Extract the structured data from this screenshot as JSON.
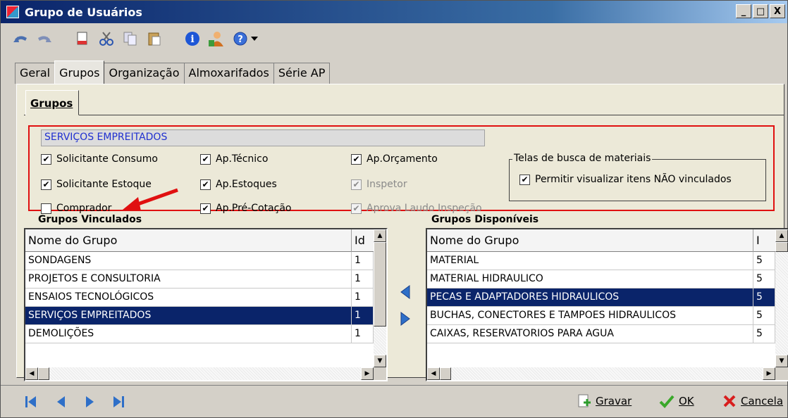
{
  "window": {
    "title": "Grupo de Usuários"
  },
  "titlebar_buttons": [
    "_",
    "□",
    "X"
  ],
  "toolbar": {
    "icons": [
      "undo-icon",
      "redo-icon",
      "new-document-icon",
      "cut-icon",
      "copy-icon",
      "paste-icon",
      "info-icon",
      "user-icon",
      "help-icon",
      "dropdown-arrow-icon"
    ]
  },
  "tabs": [
    {
      "label": "Geral",
      "active": false
    },
    {
      "label": "Grupos",
      "active": true
    },
    {
      "label": "Organização",
      "active": false
    },
    {
      "label": "Almoxarifados",
      "active": false
    },
    {
      "label": "Série AP",
      "active": false
    }
  ],
  "subtab": {
    "label": "Grupos"
  },
  "group_name": "SERVIÇOS EMPREITADOS",
  "checkboxes": {
    "col1": [
      {
        "label": "Solicitante Consumo",
        "checked": true,
        "disabled": false
      },
      {
        "label": "Solicitante Estoque",
        "checked": true,
        "disabled": false
      },
      {
        "label": "Comprador",
        "checked": false,
        "disabled": false
      }
    ],
    "col2": [
      {
        "label": "Ap.Técnico",
        "checked": true,
        "disabled": false
      },
      {
        "label": "Ap.Estoques",
        "checked": true,
        "disabled": false
      },
      {
        "label": "Ap.Pré-Cotação",
        "checked": true,
        "disabled": false
      }
    ],
    "col3": [
      {
        "label": "Ap.Orçamento",
        "checked": true,
        "disabled": false
      },
      {
        "label": "Inspetor",
        "checked": true,
        "disabled": true
      },
      {
        "label": "Aprova Laudo Inspeção",
        "checked": true,
        "disabled": true
      }
    ]
  },
  "search_screens": {
    "legend": "Telas de busca de materiais",
    "option": {
      "label": "Permitir visualizar itens NÃO vinculados",
      "checked": true
    }
  },
  "linked_groups": {
    "title": "Grupos Vinculados",
    "columns": [
      "Nome do Grupo",
      "Id"
    ],
    "rows": [
      {
        "name": "SONDAGENS",
        "id": "1",
        "selected": false
      },
      {
        "name": "PROJETOS E CONSULTORIA",
        "id": "1",
        "selected": false
      },
      {
        "name": "ENSAIOS TECNOLÓGICOS",
        "id": "1",
        "selected": false
      },
      {
        "name": "SERVIÇOS EMPREITADOS",
        "id": "1",
        "selected": true
      },
      {
        "name": "DEMOLIÇÕES",
        "id": "1",
        "selected": false
      }
    ]
  },
  "available_groups": {
    "title": "Grupos Disponíveis",
    "columns": [
      "Nome do Grupo",
      "I"
    ],
    "rows": [
      {
        "name": "MATERIAL",
        "id": "5",
        "selected": false
      },
      {
        "name": "MATERIAL HIDRAULICO",
        "id": "5",
        "selected": false
      },
      {
        "name": "PECAS E ADAPTADORES HIDRAULICOS",
        "id": "5",
        "selected": true
      },
      {
        "name": "BUCHAS, CONECTORES E TAMPOES HIDRAULICOS",
        "id": "5",
        "selected": false
      },
      {
        "name": "CAIXAS, RESERVATORIOS PARA AGUA",
        "id": "5",
        "selected": false
      }
    ]
  },
  "actions": {
    "save": "Gravar",
    "ok": "OK",
    "cancel": "Cancela"
  },
  "colors": {
    "selection": "#0a246a",
    "annotation_red": "#e01010",
    "group_name_text": "#2030d0"
  }
}
